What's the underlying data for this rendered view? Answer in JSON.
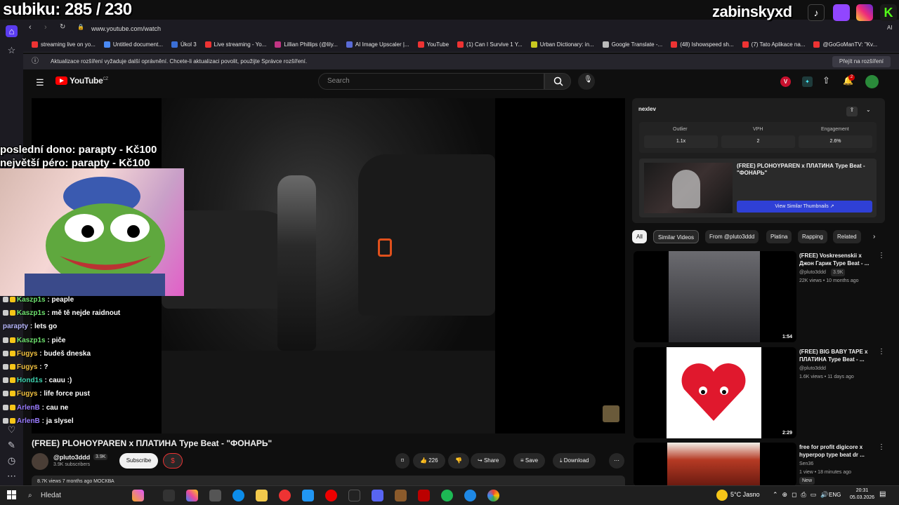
{
  "overlay": {
    "sub_counter": "subiku: 285 / 230",
    "streamer_name": "zabinskyxd",
    "donation_last": "poslední dono: parapty - Kč100",
    "donation_top": "největší péro: parapty - Kč100"
  },
  "browser": {
    "url": "www.youtube.com/watch",
    "bookmarks": [
      {
        "label": "streaming live on yo...",
        "color": "#e33"
      },
      {
        "label": "Untitled document...",
        "color": "#4a8af4"
      },
      {
        "label": "Úkol 3",
        "color": "#3b6fd6"
      },
      {
        "label": "Live streaming - Yo...",
        "color": "#e33"
      },
      {
        "label": "Lillian Phillips (@lily...",
        "color": "#c13584"
      },
      {
        "label": "AI Image Upscaler |...",
        "color": "#5a6bd6"
      },
      {
        "label": "YouTube",
        "color": "#e33"
      },
      {
        "label": "(1) Can I Survive 1 Y...",
        "color": "#e33"
      },
      {
        "label": "Urban Dictionary: in...",
        "color": "#c8c820"
      },
      {
        "label": "Google Translate -...",
        "color": "#bbb"
      },
      {
        "label": "(48) Ishowspeed sh...",
        "color": "#e33"
      },
      {
        "label": "(7) Tato Aplikace na...",
        "color": "#e33"
      },
      {
        "label": "@GoGoManTV: \"Kv...",
        "color": "#e33"
      }
    ],
    "notice_text": "Aktualizace rozšíření vyžaduje další oprávnění. Chcete-li aktualizaci povolit, použijte Správce rozšíření.",
    "notice_button": "Přejít na rozšíření",
    "ai_label": "AI"
  },
  "youtube": {
    "logo_text": "YouTube",
    "logo_region": "CZ",
    "search_placeholder": "Search",
    "notification_count": "2",
    "video": {
      "title": "(FREE) PLOHOYPAREN x ПЛАТИНА Type Beat - \"ФОНАРЬ\"",
      "channel": "@pluto3ddd",
      "channel_badge": "3.9K",
      "subscribers": "3.9K subscribers",
      "subscribe_label": "Subscribe",
      "likes": "226",
      "share_label": "Share",
      "save_label": "Save",
      "download_label": "Download",
      "description": "8.7K views 7 months ago МОСКВА"
    },
    "extension": {
      "logo": "nexlev",
      "stats": [
        {
          "label": "Outlier",
          "value": "1.1x"
        },
        {
          "label": "VPH",
          "value": "2"
        },
        {
          "label": "Engagement",
          "value": "2.6%"
        }
      ],
      "thumb_title": "(FREE) PLOHOYPAREN x ПЛАТИНА Type Beat - \"ФОНАРЬ\"",
      "similar_button": "View Similar Thumbnails"
    },
    "chips": [
      "All",
      "Similar Videos",
      "From @pluto3ddd",
      "Platina",
      "Rapping",
      "Related"
    ],
    "recommendations": [
      {
        "title": "(FREE) Voskresenskii x Джон Гарик Type Beat - ...",
        "channel": "@pluto3ddd",
        "badge": "3.9K",
        "meta": "22K views • 10 months ago",
        "duration": "1:54"
      },
      {
        "title": "(FREE) BIG BABY TAPE x ПЛАТИНА Type Beat - ...",
        "channel": "@pluto3ddd",
        "badge": "",
        "meta": "1.6K views • 11 days ago",
        "duration": "2:29"
      },
      {
        "title": "free for profit digicore x hyperpop type beat dr ...",
        "channel": "Sen36",
        "badge": "",
        "meta": "1 view • 18 minutes ago",
        "tag": "New",
        "duration": ""
      }
    ]
  },
  "chat": [
    {
      "user": "Kaszp1s",
      "color": "#6ee36e",
      "msg": "peaple",
      "badges": true
    },
    {
      "user": "Kaszp1s",
      "color": "#6ee36e",
      "msg": "mě tě nejde raidnout",
      "badges": true
    },
    {
      "user": "parapty",
      "color": "#b8b8ff",
      "msg": "lets go",
      "badges": false
    },
    {
      "user": "Kaszp1s",
      "color": "#6ee36e",
      "msg": "piče",
      "badges": true
    },
    {
      "user": "Fugys",
      "color": "#f0c040",
      "msg": "budeš dneska",
      "badges": true
    },
    {
      "user": "Fugys",
      "color": "#f0c040",
      "msg": "?",
      "badges": true
    },
    {
      "user": "Hond1s",
      "color": "#3fd4b0",
      "msg": "cauu :)",
      "badges": true
    },
    {
      "user": "Fugys",
      "color": "#f0c040",
      "msg": "life force       pust",
      "badges": true
    },
    {
      "user": "ArlenB",
      "color": "#9a7cff",
      "msg": "cau ne",
      "badges": true
    },
    {
      "user": "ArlenB",
      "color": "#9a7cff",
      "msg": "ja slysel",
      "badges": true
    }
  ],
  "taskbar": {
    "search_placeholder": "Hledat",
    "weather": "5°C  Jasno",
    "lang": "ENG",
    "time": "20:31",
    "date": "05.03.2026"
  }
}
